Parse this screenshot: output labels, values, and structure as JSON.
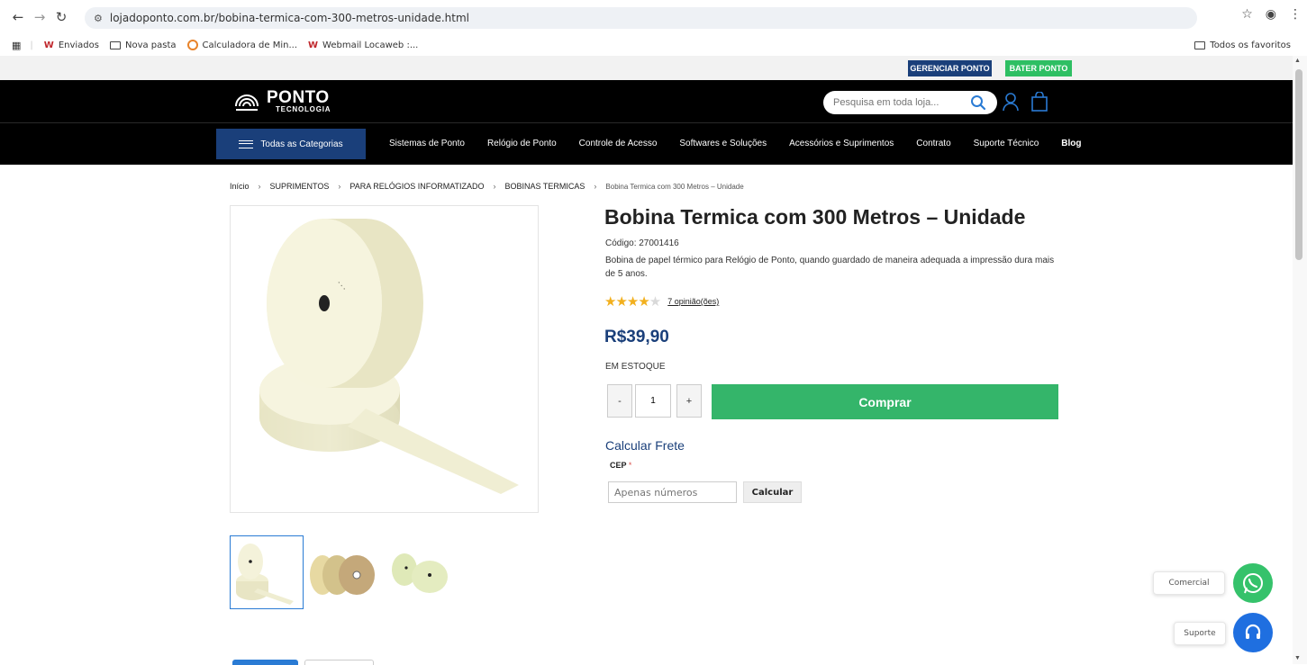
{
  "browser": {
    "url": "lojadoponto.com.br/bobina-termica-com-300-metros-unidade.html",
    "bookmarks": [
      "Enviados",
      "Nova pasta",
      "Calculadora de Min...",
      "Webmail Locaweb :..."
    ],
    "all_favorites": "Todos os favoritos"
  },
  "topbar": {
    "gerenciar": "GERENCIAR PONTO",
    "bater": "BATER PONTO",
    "gerenciar_color": "#1a3f7a",
    "bater_color": "#2ebf63"
  },
  "logo": {
    "line1": "PONTO",
    "line2": "TECNOLOGIA"
  },
  "search": {
    "placeholder": "Pesquisa em toda loja..."
  },
  "nav": {
    "categories": "Todas as Categorias",
    "links": [
      "Sistemas de Ponto",
      "Relógio de Ponto",
      "Controle de Acesso",
      "Softwares e Soluções",
      "Acessórios e Suprimentos",
      "Contrato",
      "Suporte Técnico",
      "Blog"
    ]
  },
  "breadcrumb": [
    "Início",
    "SUPRIMENTOS",
    "PARA RELÓGIOS INFORMATIZADO",
    "BOBINAS TERMICAS",
    "Bobina Termica com 300 Metros – Unidade"
  ],
  "product": {
    "title": "Bobina Termica com 300 Metros – Unidade",
    "codigo_label": "Código:",
    "codigo": "27001416",
    "description": "Bobina de papel térmico para Relógio de Ponto, quando guardado de maneira adequada a impressão dura mais de 5 anos.",
    "rating": 4.5,
    "reviews": "7 opinião(ões)",
    "price": "R$39,90",
    "stock": "EM ESTOQUE",
    "qty": "1",
    "minus": "-",
    "plus": "+",
    "buy": "Comprar",
    "accent_color": "#34b56a"
  },
  "frete": {
    "title": "Calcular Frete",
    "cep_label": "CEP",
    "required": "*",
    "placeholder": "Apenas números",
    "button": "Calcular"
  },
  "chat": {
    "comercial": "Comercial",
    "suporte": "Suporte"
  }
}
